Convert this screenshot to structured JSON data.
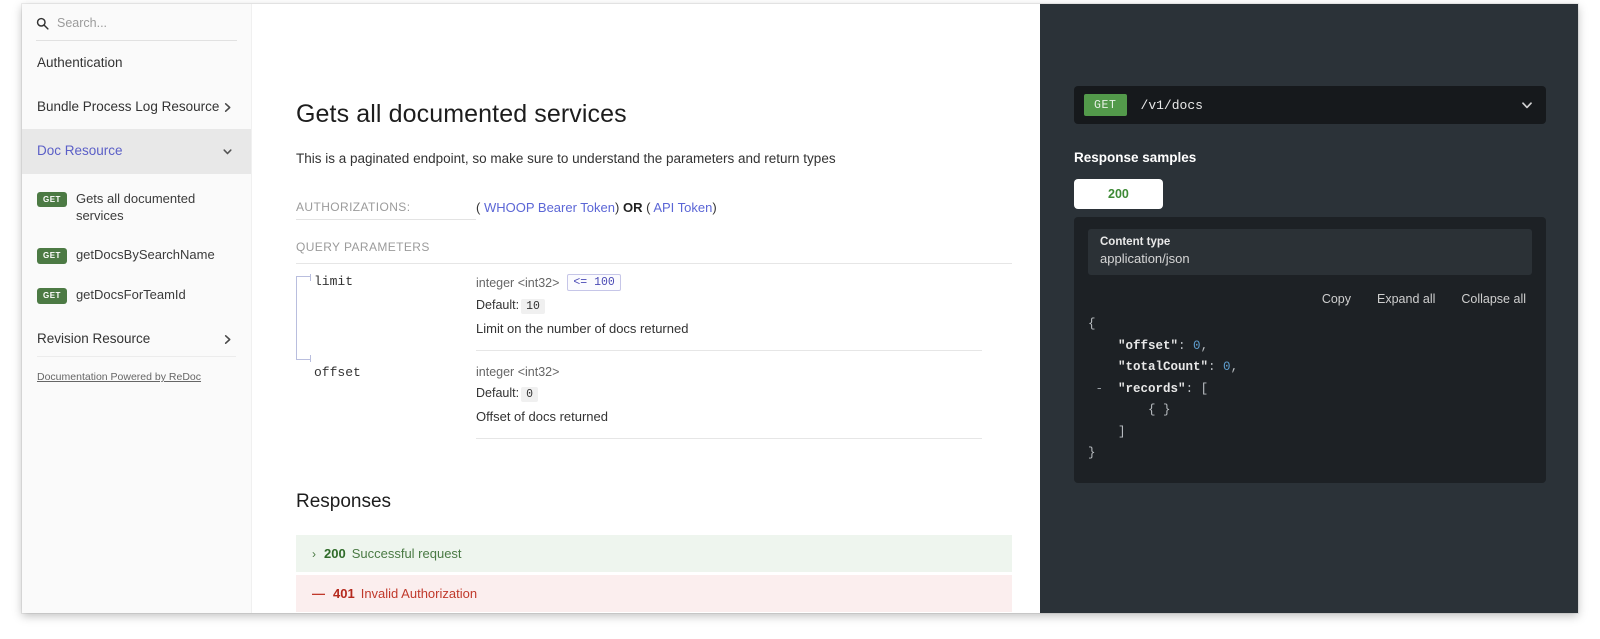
{
  "sidebar": {
    "search": {
      "placeholder": "Search...",
      "value": "",
      "icon": "search-icon"
    },
    "groups": [
      {
        "label": "Authentication",
        "chevron": ""
      },
      {
        "label": "Bundle Process Log Resource",
        "chevron": "chevron-right-icon"
      },
      {
        "label": "Doc Resource",
        "chevron": "chevron-down-icon",
        "active": true
      }
    ],
    "operations": [
      {
        "method": "GET",
        "label": "Gets all documented services"
      },
      {
        "method": "GET",
        "label": "getDocsBySearchName"
      },
      {
        "method": "GET",
        "label": "getDocsForTeamId"
      }
    ],
    "group_after": {
      "label": "Revision Resource",
      "chevron": "chevron-right-icon"
    },
    "footer_link": "Documentation Powered by ReDoc"
  },
  "main": {
    "title": "Gets all documented services",
    "description": "This is a paginated endpoint, so make sure to understand the parameters and return types",
    "authorizations": {
      "key": "AUTHORIZATIONS:",
      "open_paren": "(",
      "token_1": "WHOOP Bearer Token",
      "close_paren_1": ")",
      "operator": "OR",
      "open_paren_2": "(",
      "token_2": "API Token",
      "close_paren_2": ")"
    },
    "query_parameters_header": "QUERY PARAMETERS",
    "parameters": [
      {
        "name": "limit",
        "type": "integer <int32>",
        "constraint": "<= 100",
        "default_label": "Default:",
        "default_value": "10",
        "description": "Limit on the number of docs returned"
      },
      {
        "name": "offset",
        "type": "integer <int32>",
        "constraint": "",
        "default_label": "Default:",
        "default_value": "0",
        "description": "Offset of docs returned"
      }
    ],
    "responses_title": "Responses",
    "responses": [
      {
        "caret": "›",
        "code": "200",
        "text": "Successful request",
        "state": "collapsed"
      },
      {
        "caret": "—",
        "code": "401",
        "text": "Invalid Authorization",
        "state": "none"
      }
    ]
  },
  "right_panel": {
    "method": "GET",
    "path": "/v1/docs",
    "endpoint_chevron": "chevron-down-icon",
    "response_samples_title": "Response samples",
    "tabs": [
      {
        "label": "200",
        "selected": true
      }
    ],
    "content_type_label": "Content type",
    "content_type_value": "application/json",
    "actions": {
      "copy": "Copy",
      "expand": "Expand all",
      "collapse": "Collapse all"
    },
    "json_sample": {
      "line_1": "{",
      "key_offset": "\"offset\"",
      "val_offset": "0",
      "key_totalCount": "\"totalCount\"",
      "val_totalCount": "0",
      "minus": "-",
      "key_records": "\"records\"",
      "records_open": "[",
      "records_item": "{ }",
      "records_close": "]",
      "line_last": "}"
    }
  },
  "colors": {
    "method_green": "#539a4b",
    "badge_green": "#4c7a44",
    "panel_dark": "#2b3238",
    "code_dark": "#1d2125",
    "link_purple": "#5b66d6",
    "success_green": "#2f6b29",
    "error_red": "#b5291d"
  }
}
